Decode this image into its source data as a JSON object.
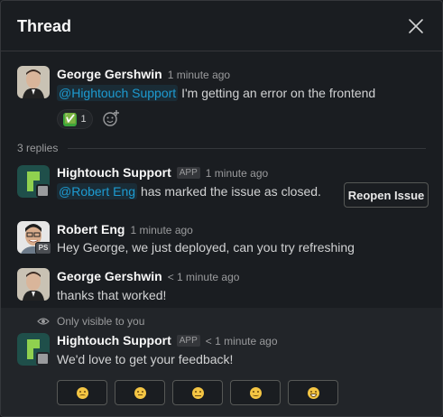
{
  "header": {
    "title": "Thread"
  },
  "parent": {
    "sender": "George Gershwin",
    "time": "1 minute ago",
    "mention": "@Hightouch Support",
    "text": "I'm getting an error on the frontend",
    "reaction": {
      "emoji": "✅",
      "count": "1"
    }
  },
  "replies_label": "3 replies",
  "replies": [
    {
      "sender": "Hightouch Support",
      "badge": "APP",
      "time": "1 minute ago",
      "mention": "@Robert Eng",
      "text": "has marked the issue as closed.",
      "button": "Reopen Issue"
    },
    {
      "sender": "Robert Eng",
      "time": "1 minute ago",
      "avatar_badge": "PS",
      "text": "Hey George, we just deployed, can you try refreshing"
    },
    {
      "sender": "George Gershwin",
      "time": "< 1 minute ago",
      "text": "thanks that worked!"
    }
  ],
  "ephemeral": {
    "label": "Only visible to you",
    "sender": "Hightouch Support",
    "badge": "APP",
    "time": "< 1 minute ago",
    "text": "We'd love to get your feedback!",
    "feedback_buttons": [
      "very-dissatisfied",
      "slightly-dissatisfied",
      "neutral",
      "satisfied",
      "very-satisfied"
    ]
  },
  "colors": {
    "background": "#1a1d21",
    "mention": "#1d9bd1",
    "ephemeral_bg": "#222529",
    "app_logo_bg": "#1f4f4a",
    "app_logo_green": "#8fd14f"
  }
}
